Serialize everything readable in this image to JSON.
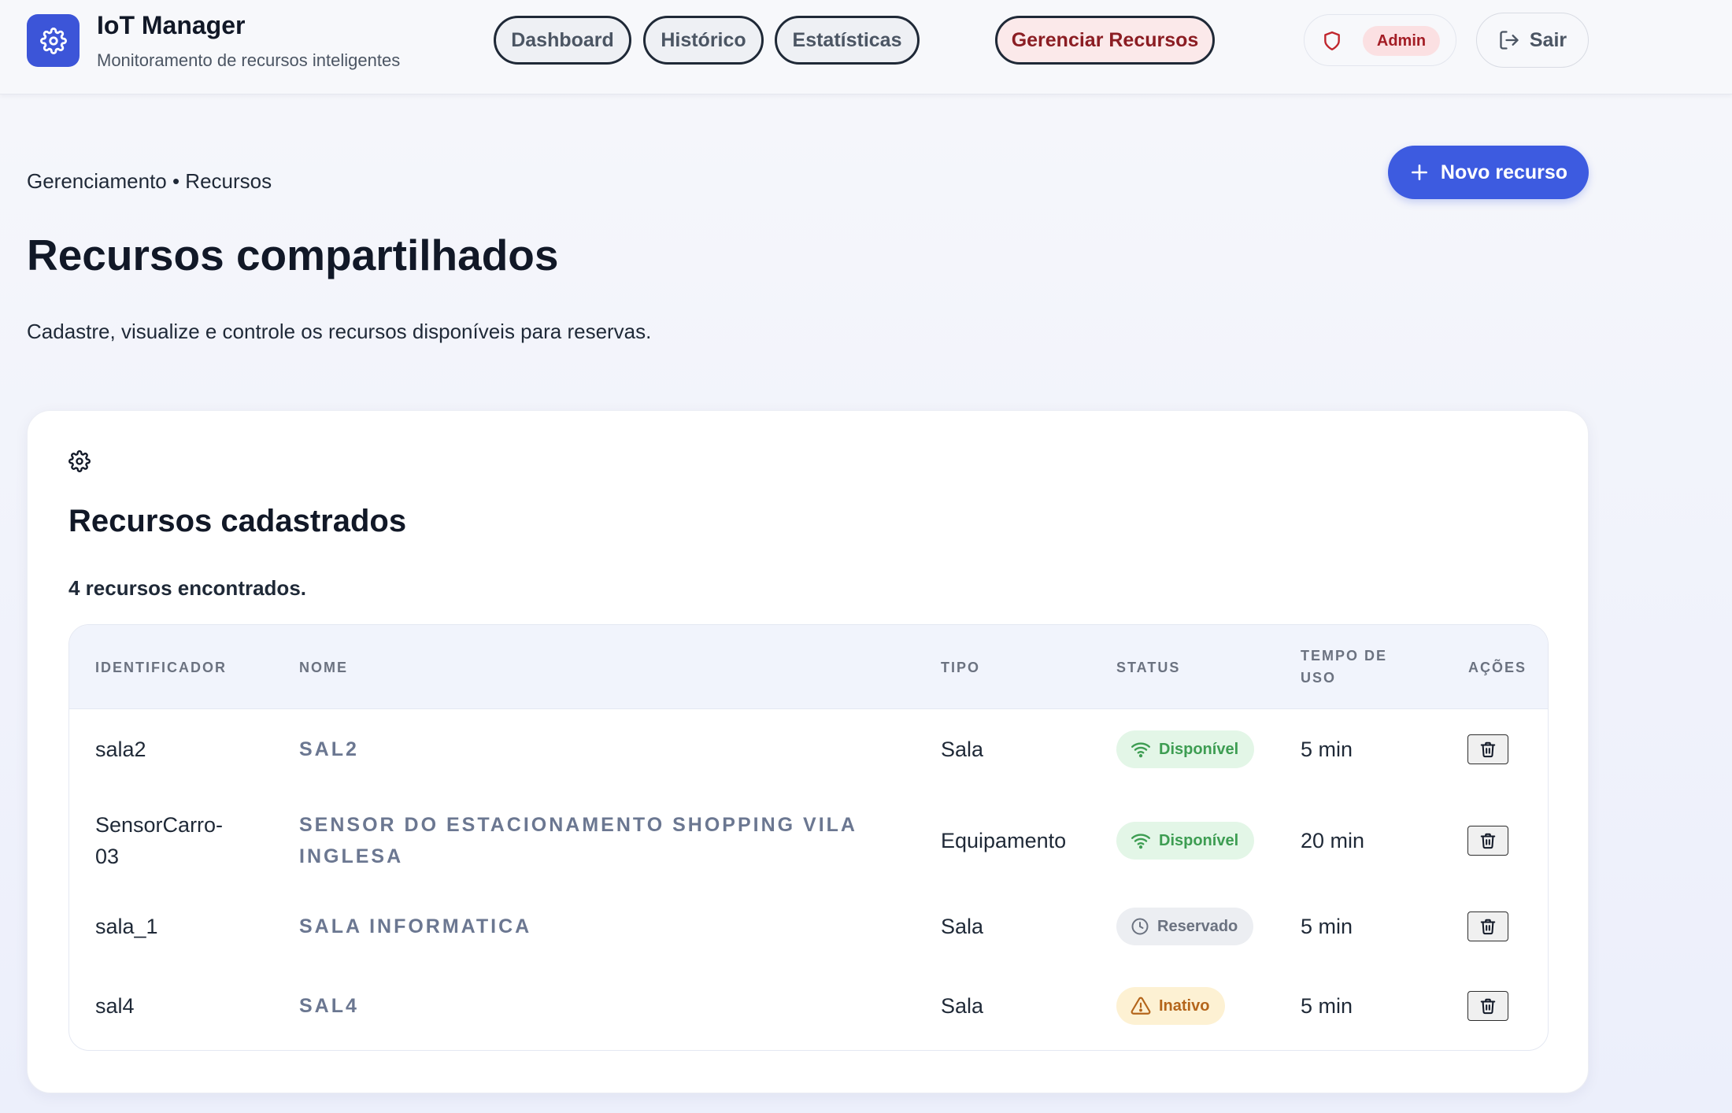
{
  "header": {
    "app_title": "IoT Manager",
    "app_subtitle": "Monitoramento de recursos inteligentes",
    "nav": {
      "dashboard": "Dashboard",
      "historico": "Histórico",
      "estatisticas": "Estatísticas",
      "gerenciar": "Gerenciar Recursos"
    },
    "role_badge": "Admin",
    "logout_label": "Sair"
  },
  "page": {
    "breadcrumb": "Gerenciamento • Recursos",
    "new_button_label": "Novo recurso",
    "title": "Recursos compartilhados",
    "description": "Cadastre, visualize e controle os recursos disponíveis para reservas."
  },
  "card": {
    "title": "Recursos cadastrados",
    "count_text": "4 recursos encontrados.",
    "columns": {
      "id": "Identificador",
      "name": "Nome",
      "type": "Tipo",
      "status": "Status",
      "time_line1": "Tempo de",
      "time_line2": "uso",
      "actions": "Ações"
    },
    "rows": [
      {
        "id": "sala2",
        "name": "SAL2",
        "type": "Sala",
        "status": "Disponível",
        "time": "5 min"
      },
      {
        "id_line1": "SensorCarro-",
        "id_line2": "03",
        "name_line1": "Sensor do estacionamento shopping vila",
        "name_line2": "inglesa",
        "type": "Equipamento",
        "status": "Disponível",
        "time": "20 min"
      },
      {
        "id": "sala_1",
        "name": "SALA INFORMATICA",
        "type": "Sala",
        "status": "Reservado",
        "time": "5 min"
      },
      {
        "id": "sal4",
        "name": "SAL4",
        "type": "Sala",
        "status": "Inativo",
        "time": "5 min"
      }
    ]
  },
  "colors": {
    "primary": "#3d5be0",
    "active_nav_bg": "#fbe9ea",
    "status_available": "#3d9d52",
    "status_reserved": "#6b7280",
    "status_inactive": "#b4651b"
  },
  "icons": {
    "logo": "gear-icon",
    "role": "shield-icon",
    "logout": "logout-icon",
    "new": "plus-icon",
    "card": "gear-icon",
    "available": "wifi-icon",
    "reserved": "clock-icon",
    "inactive": "warning-icon",
    "delete": "trash-icon"
  }
}
